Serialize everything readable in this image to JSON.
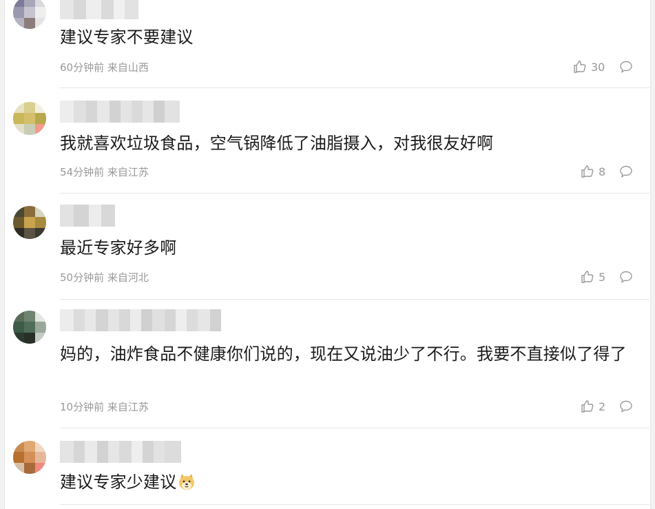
{
  "comments": [
    {
      "text": "建议专家不要建议",
      "meta": "60分钟前 来自山西",
      "likes": "30"
    },
    {
      "text": "我就喜欢垃圾食品，空气锅降低了油脂摄入，对我很友好啊",
      "meta": "54分钟前 来自江苏",
      "likes": "8"
    },
    {
      "text": "最近专家好多啊",
      "meta": "50分钟前 来自河北",
      "likes": "5"
    },
    {
      "text": "妈的，油炸食品不健康你们说的，现在又说油少了不行。我要不直接似了得了",
      "meta": "10分钟前 来自江苏",
      "likes": "2"
    },
    {
      "text": "建议专家少建议",
      "emoji": "doge-emoji"
    }
  ],
  "colors": {
    "text": "#1a1a1a",
    "meta": "#999999",
    "divider": "#e6e6e6"
  },
  "icons": {
    "like": "thumbs-up-icon",
    "reply": "comment-bubble-icon"
  }
}
